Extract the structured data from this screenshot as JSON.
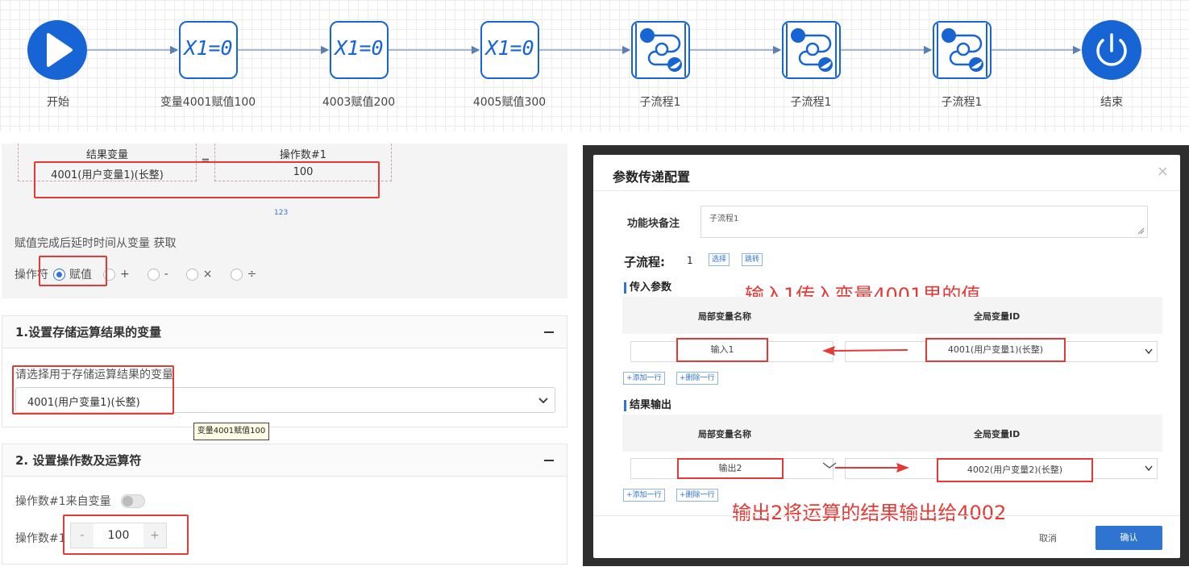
{
  "flow": {
    "nodes": [
      {
        "label": "开始",
        "type": "start",
        "text": ""
      },
      {
        "label": "变量4001赋值100",
        "type": "assign",
        "text": "X1=0"
      },
      {
        "label": "4003赋值200",
        "type": "assign",
        "text": "X1=0"
      },
      {
        "label": "4005赋值300",
        "type": "assign",
        "text": "X1=0"
      },
      {
        "label": "子流程1",
        "type": "subflow",
        "text": ""
      },
      {
        "label": "子流程1",
        "type": "subflow",
        "text": ""
      },
      {
        "label": "子流程1",
        "type": "subflow",
        "text": ""
      },
      {
        "label": "结束",
        "type": "end",
        "text": ""
      }
    ],
    "accent": "#1765d4"
  },
  "assign_panel": {
    "result_var_header": "结果变量",
    "operand_header": "操作数#1",
    "equals": "=",
    "result_var_value": "4001(用户变量1)(长整)",
    "operand_value": "100",
    "tiny_tag": "123",
    "delay_text": "赋值完成后延时时间从变量 获取",
    "operator_label": "操作符",
    "operators": [
      {
        "label": "赋值",
        "selected": true
      },
      {
        "label": "+",
        "selected": false
      },
      {
        "label": "-",
        "selected": false
      },
      {
        "label": "×",
        "selected": false
      },
      {
        "label": "÷",
        "selected": false
      }
    ]
  },
  "section1": {
    "title": "1.设置存储运算结果的变量",
    "prompt": "请选择用于存储运算结果的变量",
    "select_value": "4001(用户变量1)(长整)",
    "tooltip": "变量4001赋值100"
  },
  "section2": {
    "title": "2. 设置操作数及运算符",
    "operand_from_var_label": "操作数#1来自变量",
    "operand_label": "操作数#1",
    "stepper_minus": "-",
    "stepper_value": "100",
    "stepper_plus": "+"
  },
  "dialog": {
    "title": "参数传递配置",
    "close": "×",
    "remark_label": "功能块备注",
    "remark_value": "子流程1",
    "subflow_label": "子流程:",
    "subflow_value": "1",
    "choose_btn": "选择",
    "jump_btn": "跳转",
    "input_section": "传入参数",
    "output_section": "结果输出",
    "col_local": "局部变量名称",
    "col_global": "全局变量ID",
    "input_row": {
      "local": "输入1",
      "global": "4001(用户变量1)(长整)"
    },
    "output_row": {
      "local": "输出2",
      "global": "4002(用户变量2)(长整)"
    },
    "add_row": "+添加一行",
    "del_row": "+删除一行",
    "cancel": "取消",
    "confirm": "确认",
    "annotation_input": "输入1传入变量4001里的值",
    "annotation_output": "输出2将运算的结果输出给4002"
  },
  "colors": {
    "red": "#e53935",
    "blue": "#2f74d0"
  }
}
